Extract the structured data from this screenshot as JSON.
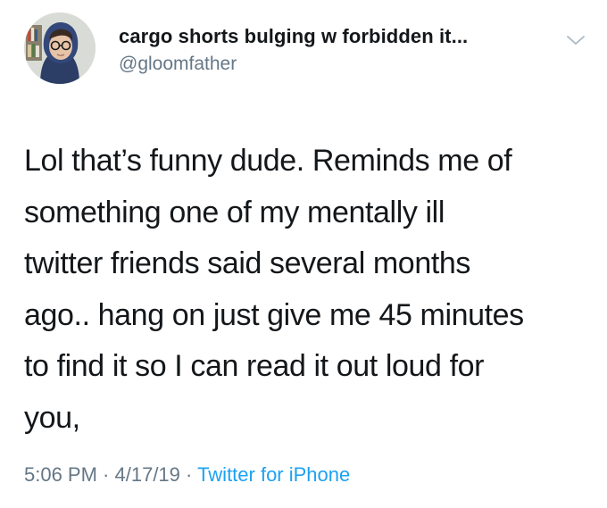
{
  "user": {
    "display_name": "cargo shorts bulging w forbidden it...",
    "handle": "@gloomfather",
    "avatar_icon": "profile-photo"
  },
  "menu": {
    "icon": "chevron-down-icon"
  },
  "tweet": {
    "lines": [
      "Lol that’s funny dude. Reminds me of",
      "something one of my mentally ill",
      "twitter friends said several months",
      "ago.. hang on just give me 45 minutes",
      "to find it so I can read it out loud for",
      "you,"
    ]
  },
  "meta": {
    "time": "5:06 PM",
    "separator": " · ",
    "date": "4/17/19",
    "source": "Twitter for iPhone"
  },
  "colors": {
    "text": "#14171a",
    "secondary": "#657786",
    "link": "#1da1f2"
  }
}
